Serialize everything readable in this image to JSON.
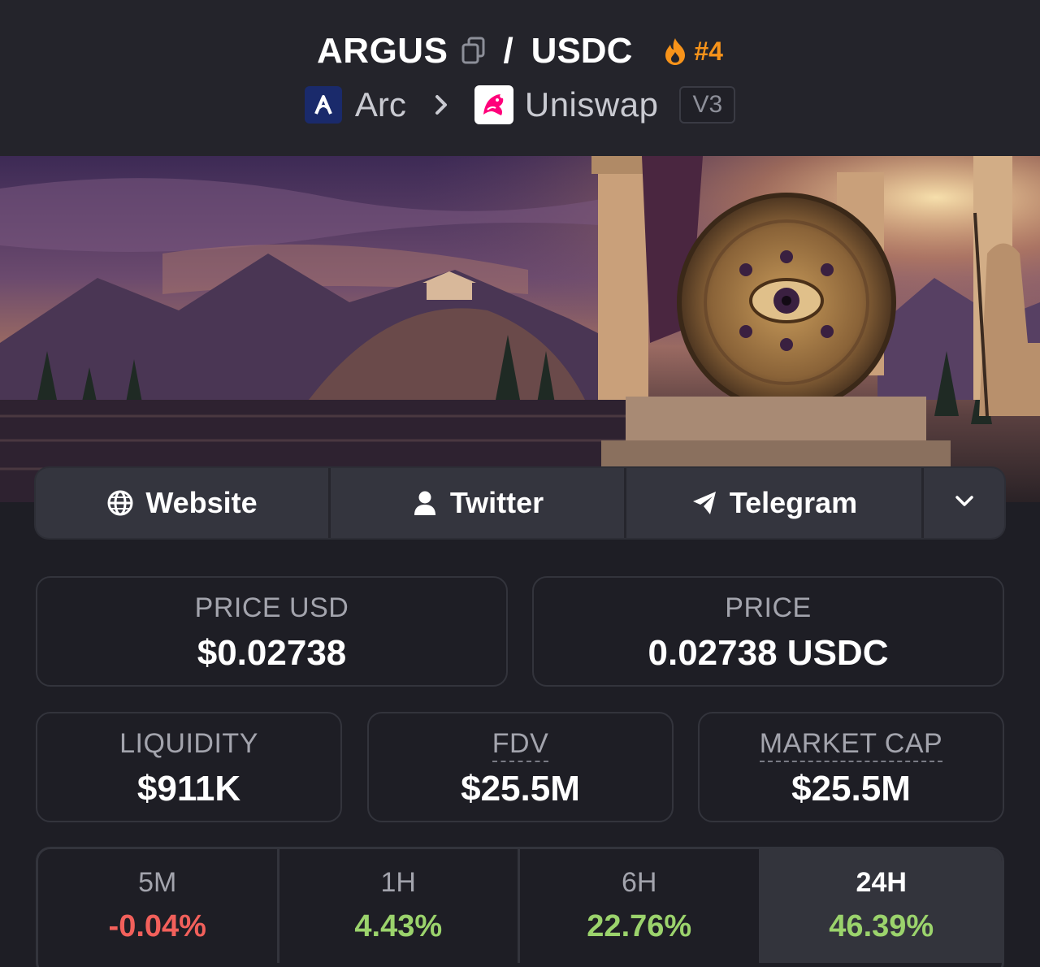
{
  "pair": {
    "base": "ARGUS",
    "separator": "/",
    "quote": "USDC",
    "rank": "#4"
  },
  "chain": {
    "name": "Arc",
    "logo_letter": "A",
    "dex": "Uniswap",
    "version": "V3"
  },
  "links": {
    "website": "Website",
    "twitter": "Twitter",
    "telegram": "Telegram"
  },
  "stats": {
    "price_usd_label": "PRICE USD",
    "price_usd_value": "$0.02738",
    "price_label": "PRICE",
    "price_value": "0.02738 USDC",
    "liquidity_label": "LIQUIDITY",
    "liquidity_value": "$911K",
    "fdv_label": "FDV",
    "fdv_value": "$25.5M",
    "mcap_label": "MARKET CAP",
    "mcap_value": "$25.5M"
  },
  "timeframes": [
    {
      "label": "5M",
      "change": "-0.04%"
    },
    {
      "label": "1H",
      "change": "4.43%"
    },
    {
      "label": "6H",
      "change": "22.76%"
    },
    {
      "label": "24H",
      "change": "46.39%"
    }
  ],
  "colors": {
    "background": "#1e1e25",
    "header": "#24242b",
    "rank_accent": "#f7931a",
    "negative": "#f2605b",
    "positive": "#9bd36c"
  },
  "icons": [
    "copy-icon",
    "flame-icon",
    "arc-logo",
    "chevron-right-icon",
    "uniswap-logo",
    "globe-icon",
    "user-icon",
    "send-icon",
    "chevron-down-icon"
  ]
}
